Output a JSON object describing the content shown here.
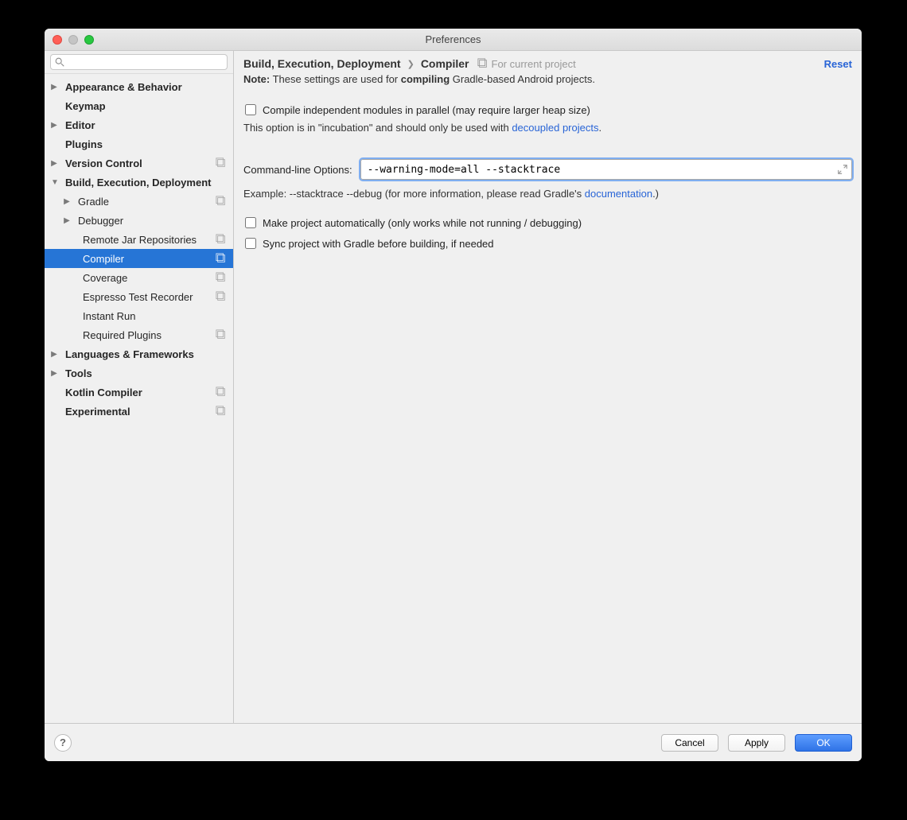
{
  "window": {
    "title": "Preferences"
  },
  "sidebar": {
    "search_placeholder": "",
    "items": [
      {
        "label": "Appearance & Behavior",
        "level": 0,
        "bold": true,
        "arrow": "right",
        "badge": false
      },
      {
        "label": "Keymap",
        "level": 0,
        "bold": true,
        "arrow": "",
        "badge": false
      },
      {
        "label": "Editor",
        "level": 0,
        "bold": true,
        "arrow": "right",
        "badge": false
      },
      {
        "label": "Plugins",
        "level": 0,
        "bold": true,
        "arrow": "",
        "badge": false
      },
      {
        "label": "Version Control",
        "level": 0,
        "bold": true,
        "arrow": "right",
        "badge": true
      },
      {
        "label": "Build, Execution, Deployment",
        "level": 0,
        "bold": true,
        "arrow": "down",
        "badge": false
      },
      {
        "label": "Gradle",
        "level": 1,
        "bold": false,
        "arrow": "right",
        "badge": true
      },
      {
        "label": "Debugger",
        "level": 1,
        "bold": false,
        "arrow": "right",
        "badge": false
      },
      {
        "label": "Remote Jar Repositories",
        "level": 2,
        "bold": false,
        "arrow": "",
        "badge": true
      },
      {
        "label": "Compiler",
        "level": 2,
        "bold": false,
        "arrow": "",
        "badge": true,
        "selected": true
      },
      {
        "label": "Coverage",
        "level": 2,
        "bold": false,
        "arrow": "",
        "badge": true
      },
      {
        "label": "Espresso Test Recorder",
        "level": 2,
        "bold": false,
        "arrow": "",
        "badge": true
      },
      {
        "label": "Instant Run",
        "level": 2,
        "bold": false,
        "arrow": "",
        "badge": false
      },
      {
        "label": "Required Plugins",
        "level": 2,
        "bold": false,
        "arrow": "",
        "badge": true
      },
      {
        "label": "Languages & Frameworks",
        "level": 0,
        "bold": true,
        "arrow": "right",
        "badge": false
      },
      {
        "label": "Tools",
        "level": 0,
        "bold": true,
        "arrow": "right",
        "badge": false
      },
      {
        "label": "Kotlin Compiler",
        "level": 0,
        "bold": true,
        "arrow": "",
        "badge": true
      },
      {
        "label": "Experimental",
        "level": 0,
        "bold": true,
        "arrow": "",
        "badge": true
      }
    ]
  },
  "header": {
    "crumb1": "Build, Execution, Deployment",
    "crumb2": "Compiler",
    "scope": "For current project",
    "reset": "Reset"
  },
  "note": {
    "prefix": "Note:",
    "pre": " These settings are used for ",
    "bold": "compiling",
    "post": " Gradle-based Android projects."
  },
  "form": {
    "check1_label": "Compile independent modules in parallel (may require larger heap size)",
    "check1_hint_pre": "This option is in \"incubation\" and should only be used with ",
    "check1_hint_link": "decoupled projects",
    "check1_hint_post": ".",
    "cmd_label": "Command-line Options:",
    "cmd_value": "--warning-mode=all --stacktrace",
    "example_pre": "Example: --stacktrace --debug (for more information, please read Gradle's ",
    "example_link": "documentation",
    "example_post": ".)",
    "check2_label": "Make project automatically (only works while not running / debugging)",
    "check3_label": "Sync project with Gradle before building, if needed"
  },
  "footer": {
    "cancel": "Cancel",
    "apply": "Apply",
    "ok": "OK"
  }
}
